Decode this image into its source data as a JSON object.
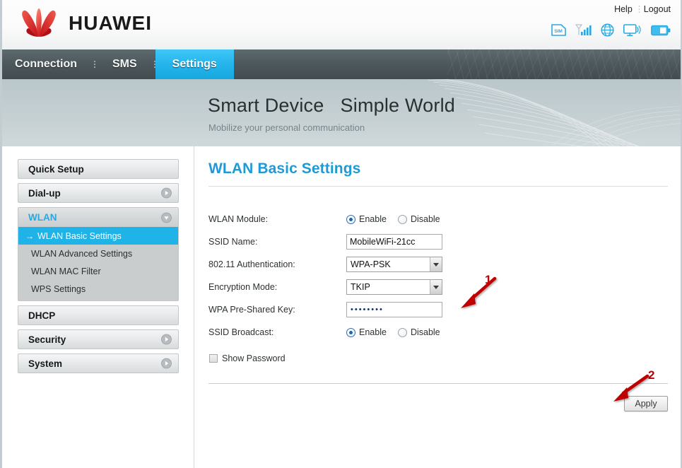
{
  "header": {
    "brand": "HUAWEI",
    "logo_icon": "huawei-flower-logo",
    "help_label": "Help",
    "logout_label": "Logout",
    "status_icons": [
      "sim-card-icon",
      "signal-bars-icon",
      "globe-icon",
      "wifi-monitor-icon",
      "battery-icon"
    ]
  },
  "nav": {
    "items": [
      {
        "label": "Connection",
        "active": false
      },
      {
        "label": "SMS",
        "active": false
      },
      {
        "label": "Settings",
        "active": true
      }
    ]
  },
  "banner": {
    "title": "Smart Device   Simple World",
    "subtitle": "Mobilize your personal communication"
  },
  "sidebar": {
    "items": [
      {
        "label": "Quick Setup",
        "icon": null,
        "expanded": false
      },
      {
        "label": "Dial-up",
        "icon": "chevron-right-circle-icon",
        "expanded": false
      },
      {
        "label": "WLAN",
        "icon": "chevron-down-circle-icon",
        "expanded": true
      },
      {
        "label": "DHCP",
        "icon": null,
        "expanded": false
      },
      {
        "label": "Security",
        "icon": "chevron-right-circle-icon",
        "expanded": false
      },
      {
        "label": "System",
        "icon": "chevron-right-circle-icon",
        "expanded": false
      }
    ],
    "wlan_submenu": [
      {
        "label": "WLAN Basic Settings",
        "selected": true
      },
      {
        "label": "WLAN Advanced Settings",
        "selected": false
      },
      {
        "label": "WLAN MAC Filter",
        "selected": false
      },
      {
        "label": "WPS Settings",
        "selected": false
      }
    ],
    "selected_arrow": "→"
  },
  "content": {
    "page_title": "WLAN Basic Settings",
    "fields": {
      "wlan_module": {
        "label": "WLAN Module:",
        "enable_label": "Enable",
        "disable_label": "Disable",
        "value": "Enable"
      },
      "ssid_name": {
        "label": "SSID Name:",
        "value": "MobileWiFi-21cc"
      },
      "authentication": {
        "label": "802.11 Authentication:",
        "value": "WPA-PSK"
      },
      "encryption_mode": {
        "label": "Encryption Mode:",
        "value": "TKIP"
      },
      "wpa_key": {
        "label": "WPA Pre-Shared Key:",
        "value": "••••••••"
      },
      "ssid_broadcast": {
        "label": "SSID Broadcast:",
        "enable_label": "Enable",
        "disable_label": "Disable",
        "value": "Enable"
      },
      "show_password": {
        "label": "Show Password",
        "checked": false
      }
    },
    "apply_label": "Apply"
  },
  "annotations": [
    {
      "number": "1",
      "target": "wpa-pre-shared-key-field"
    },
    {
      "number": "2",
      "target": "apply-button"
    }
  ],
  "colors": {
    "accent_blue": "#1f9ad6",
    "active_tab": "#25b5ec",
    "selected_item": "#1fb3e8",
    "annotation_red": "#c00000",
    "brand_red": "#e2231a"
  }
}
